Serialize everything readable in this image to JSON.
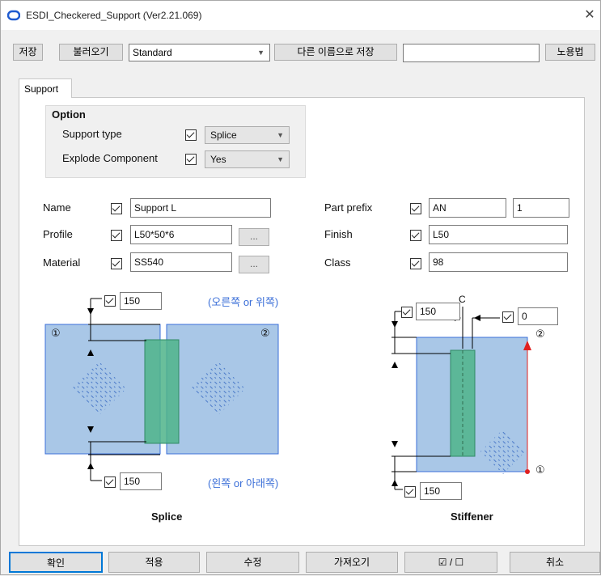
{
  "window": {
    "title": "ESDI_Checkered_Support (Ver2.21.069)",
    "close_label": "✕"
  },
  "toolbar": {
    "save_label": "저장",
    "load_label": "불러오기",
    "preset_value": "Standard",
    "save_as_label": "다른 이름으로 저장",
    "save_as_name": "",
    "extra_label": "노용법"
  },
  "tab": {
    "label": "Support"
  },
  "option": {
    "title": "Option",
    "support_type_label": "Support type",
    "support_type_value": "Splice",
    "explode_label": "Explode Component",
    "explode_value": "Yes"
  },
  "fields": {
    "name_label": "Name",
    "name_value": "Support L",
    "profile_label": "Profile",
    "profile_value": "L50*50*6",
    "material_label": "Material",
    "material_value": "SS540",
    "part_prefix_label": "Part prefix",
    "part_prefix_value": "AN",
    "part_start_value": "1",
    "finish_label": "Finish",
    "finish_value": "L50",
    "class_label": "Class",
    "class_value": "98",
    "browse_label": "..."
  },
  "splice": {
    "top_value": "150",
    "bottom_value": "150",
    "right_up_label": "(오른쪽 or 위쪽)",
    "left_down_label": "(왼쪽 or 아래쪽)",
    "marker1": "①",
    "marker2": "②",
    "caption": "Splice"
  },
  "stiffener": {
    "top_value": "150",
    "offset_value": "0",
    "bottom_value": "150",
    "centerline_label": "C",
    "marker1": "①",
    "marker2": "②",
    "caption": "Stiffener"
  },
  "footer": {
    "ok_label": "확인",
    "apply_label": "적용",
    "modify_label": "수정",
    "get_label": "가져오기",
    "toggle_label": "☑ / ☐",
    "cancel_label": "취소"
  },
  "colors": {
    "plate": "#a9c7e7",
    "plate_border": "#3b6fd8",
    "connector": "#4fb48a",
    "korean_text": "#3b6fd8",
    "marker_red": "#e02020"
  }
}
